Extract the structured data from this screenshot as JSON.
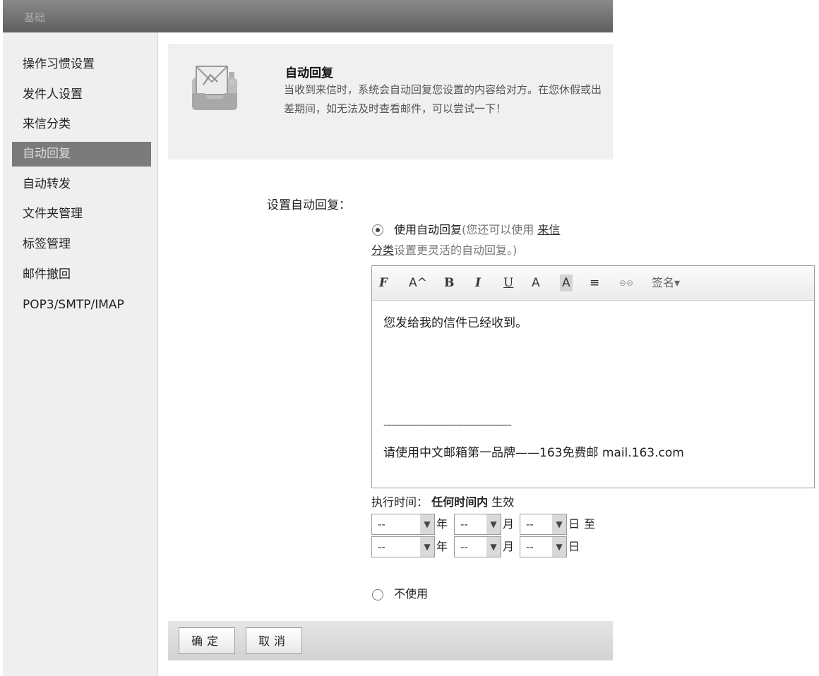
{
  "window": {
    "title": "基础"
  },
  "sidebar": {
    "items": [
      {
        "label": "操作习惯设置"
      },
      {
        "label": "发件人设置"
      },
      {
        "label": "来信分类"
      },
      {
        "label": "自动回复",
        "active": true
      },
      {
        "label": "自动转发"
      },
      {
        "label": "文件夹管理"
      },
      {
        "label": "标签管理"
      },
      {
        "label": "邮件撤回"
      },
      {
        "label": "POP3/SMTP/IMAP"
      }
    ]
  },
  "header": {
    "icon": "inbox-icon",
    "title": "自动回复",
    "description": "当收到来信时，系统会自动回复您设置的内容给对方。在您休假或出差期间，如无法及时查看邮件，可以尝试一下！"
  },
  "settings": {
    "label": "设置自动回复：",
    "use_option": {
      "label": "使用自动回复",
      "hint_prefix": "(您还可以使用 ",
      "link1": "来信",
      "link2": "分类",
      "hint_suffix": "设置更灵活的自动回复。)",
      "selected": true
    },
    "no_option": {
      "label": "不使用",
      "selected": false
    }
  },
  "editor": {
    "toolbar": {
      "font": "F",
      "size": "A^",
      "bold": "B",
      "italic": "I",
      "underline": "U",
      "color": "A",
      "bgcolor": "A",
      "align": "≡",
      "link": "⊖⊖",
      "signature": "签名▾"
    },
    "content_line1": "您发给我的信件已经收到。",
    "divider": "-------------------------------------------------",
    "signature": "请使用中文邮箱第一品牌——163免费邮  mail.163.com"
  },
  "exec_time": {
    "prefix": "执行时间：",
    "bold": "任何时间内",
    "suffix": " 生效",
    "placeholder": "--",
    "unit_year": "年",
    "unit_month": "月",
    "unit_day": "日",
    "to": "至"
  },
  "buttons": {
    "ok": "确定",
    "cancel": "取消"
  },
  "colors": {
    "active_bg": "#7b7b7b",
    "topbar": "#6e6e6e"
  }
}
